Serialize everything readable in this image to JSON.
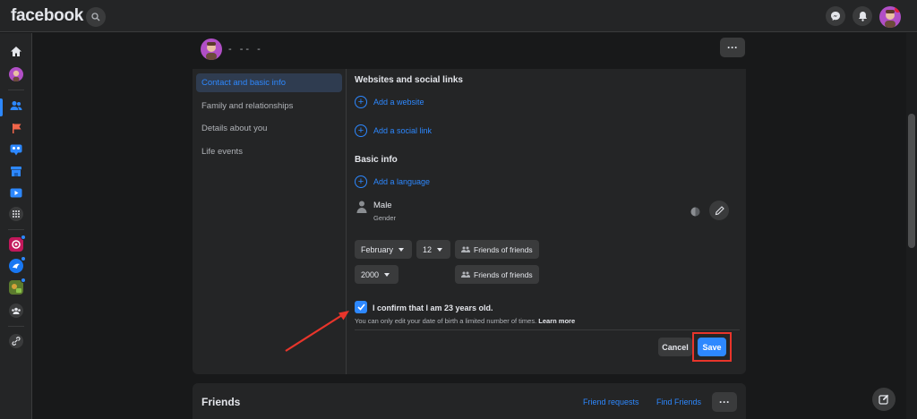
{
  "topbar": {
    "logo": "facebook",
    "icons": [
      "search-icon",
      "messenger-icon",
      "notifications-icon",
      "account-avatar"
    ]
  },
  "leftrail": {
    "icons": [
      "home-icon",
      "profile-icon",
      "friends-icon",
      "pages-icon",
      "groups-icon",
      "marketplace-icon",
      "watch-icon",
      "menu-grid-icon",
      "shortcut-1-icon",
      "shortcut-2-icon",
      "shortcut-3-icon",
      "groups-shortcut-icon",
      "link-icon"
    ]
  },
  "profile_header": {
    "name": "-          --       -",
    "more": "···"
  },
  "about_menu": [
    {
      "label": "Contact and basic info",
      "active": true
    },
    {
      "label": "Family and relationships",
      "active": false
    },
    {
      "label": "Details about you",
      "active": false
    },
    {
      "label": "Life events",
      "active": false
    }
  ],
  "websites": {
    "title": "Websites and social links",
    "add_website": "Add a website",
    "add_social": "Add a social link"
  },
  "basic_info": {
    "title": "Basic info",
    "add_language": "Add a language",
    "gender_value": "Male",
    "gender_label": "Gender"
  },
  "birthday": {
    "month": "February",
    "day": "12",
    "year": "2000",
    "audience_1": "Friends of friends",
    "audience_2": "Friends of friends"
  },
  "confirm": {
    "text": "I confirm that I am 23 years old.",
    "hint": "You can only edit your date of birth a limited number of times.",
    "link": "Learn more",
    "checked": true
  },
  "actions": {
    "cancel": "Cancel",
    "save": "Save"
  },
  "friends": {
    "title": "Friends",
    "requests": "Friend requests",
    "find": "Find Friends",
    "more": "···"
  },
  "colors": {
    "accent": "#2d88ff",
    "highlight": "#e8352b",
    "surface": "#242526",
    "background": "#18191a"
  }
}
